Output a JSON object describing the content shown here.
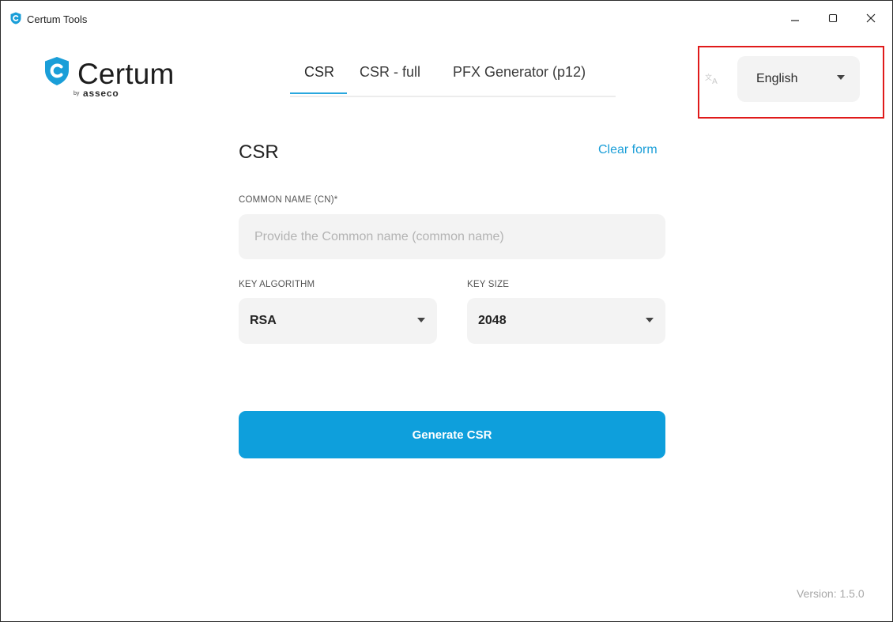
{
  "window": {
    "title": "Certum Tools",
    "controls": [
      "minimize",
      "maximize",
      "close"
    ]
  },
  "logo": {
    "brand": "Certum",
    "by": "by",
    "parent": "asseco",
    "colors": {
      "shield": "#1a9ed8"
    }
  },
  "tabs": [
    {
      "label": "CSR",
      "active": true
    },
    {
      "label": "CSR - full",
      "active": false
    },
    {
      "label": "PFX Generator (p12)",
      "active": false
    }
  ],
  "language": {
    "icon": "translate-icon",
    "selected": "English"
  },
  "form": {
    "title": "CSR",
    "clear_label": "Clear form",
    "common_name": {
      "label": "COMMON NAME (CN)*",
      "value": "",
      "placeholder": "Provide the Common name (common name)"
    },
    "key_algorithm": {
      "label": "KEY ALGORITHM",
      "value": "RSA"
    },
    "key_size": {
      "label": "KEY SIZE",
      "value": "2048"
    },
    "generate_label": "Generate CSR"
  },
  "footer": {
    "version": "Version: 1.5.0"
  },
  "colors": {
    "accent": "#0e9fdc",
    "link": "#1a9ed8",
    "highlight": "#e01a1a"
  }
}
